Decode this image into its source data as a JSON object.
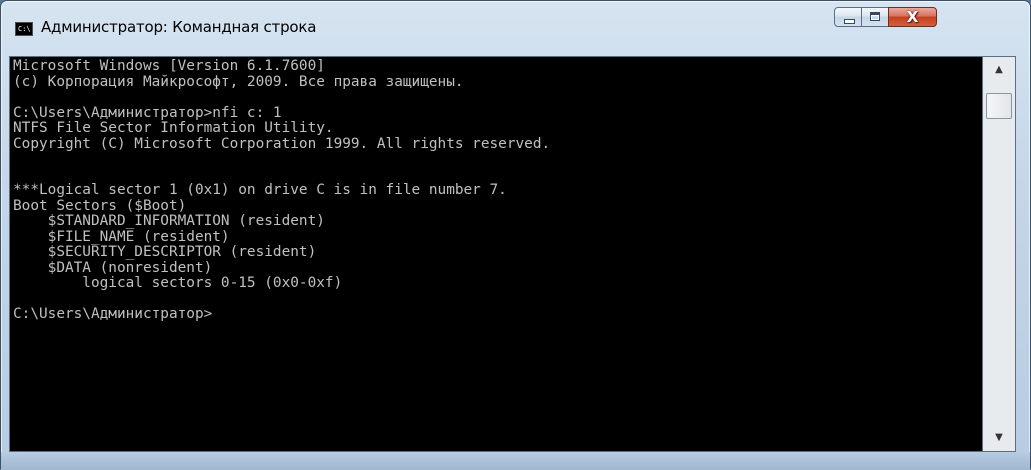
{
  "window": {
    "title": "Администратор: Командная строка",
    "app_icon_text": "C:\\"
  },
  "controls": {
    "minimize_icon": "minimize-icon",
    "maximize_icon": "maximize-icon",
    "close_glyph": "X"
  },
  "console": {
    "lines": [
      "Microsoft Windows [Version 6.1.7600]",
      "(c) Корпорация Майкрософт, 2009. Все права защищены.",
      "",
      "C:\\Users\\Администратор>nfi c: 1",
      "NTFS File Sector Information Utility.",
      "Copyright (C) Microsoft Corporation 1999. All rights reserved.",
      "",
      "",
      "***Logical sector 1 (0x1) on drive C is in file number 7.",
      "Boot Sectors ($Boot)",
      "    $STANDARD_INFORMATION (resident)",
      "    $FILE_NAME (resident)",
      "    $SECURITY_DESCRIPTOR (resident)",
      "    $DATA (nonresident)",
      "        logical sectors 0-15 (0x0-0xf)",
      "",
      "C:\\Users\\Администратор>"
    ]
  },
  "scrollbar": {
    "up_arrow": "▲",
    "down_arrow": "▼"
  },
  "colors": {
    "console_background": "#000000",
    "console_text": "#c0c0c0",
    "close_button": "#c4411f"
  }
}
